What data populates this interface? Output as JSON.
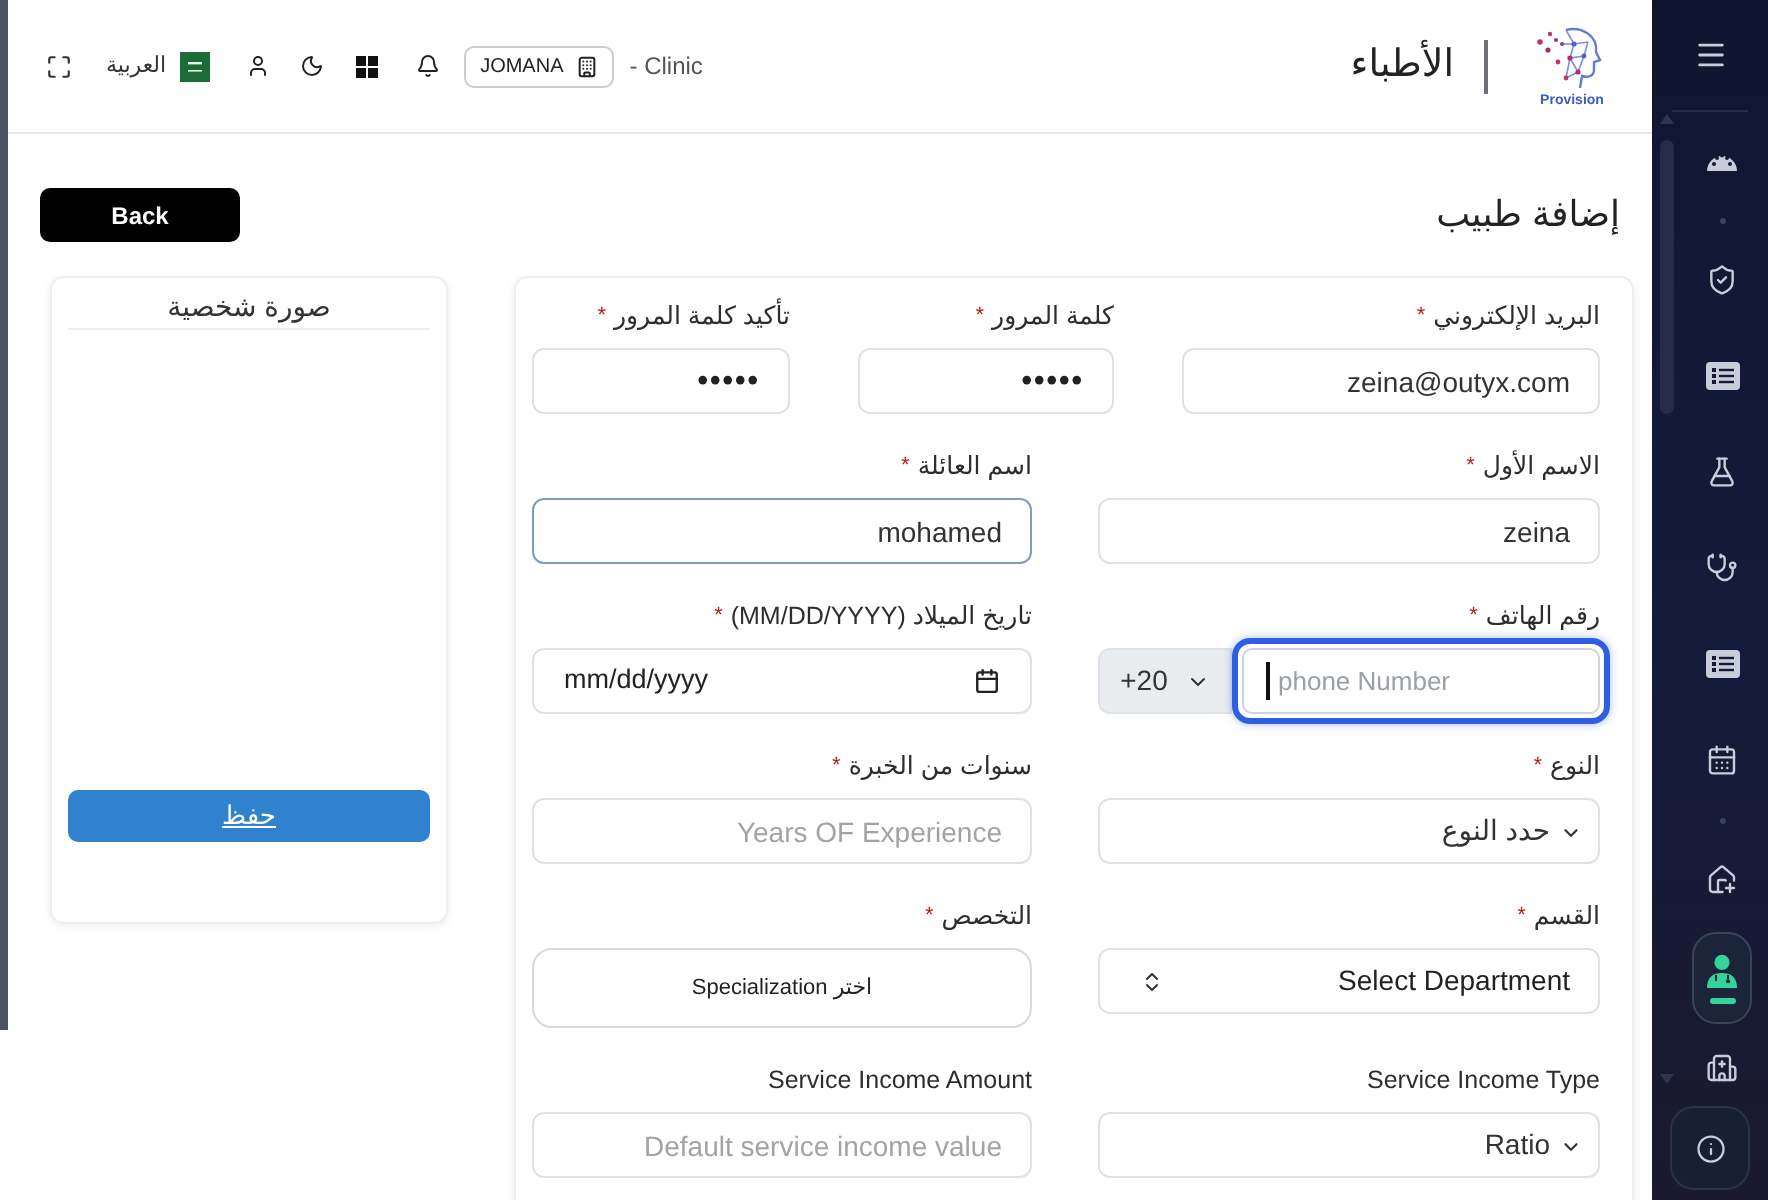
{
  "header": {
    "logo_text": "Provision",
    "title": "الأطباء",
    "language": "العربية",
    "branch": "JOMANA",
    "clinic": "- Clinic"
  },
  "page": {
    "back_button": "Back",
    "title": "إضافة طبيب"
  },
  "photo_card": {
    "title": "صورة شخصية",
    "save_button": "حفظ"
  },
  "form": {
    "rows": [
      {
        "fields": [
          {
            "kind": "text",
            "label": "البريد الإلكتروني",
            "required_mark": "*",
            "value": "zeina@outyx.com",
            "focused": false,
            "highlighted": false
          },
          {
            "kind": "password",
            "label": "كلمة المرور",
            "required_mark": "*",
            "value": "•••••",
            "focused": false,
            "highlighted": false
          },
          {
            "kind": "password",
            "label": "تأكيد كلمة المرور",
            "required_mark": "*",
            "value": "•••••",
            "focused": false,
            "highlighted": false
          }
        ]
      },
      {
        "fields": [
          {
            "kind": "text",
            "label": "الاسم الأول",
            "required_mark": "*",
            "value": "zeina",
            "focused": false,
            "highlighted": false
          },
          {
            "kind": "text",
            "label": "اسم العائلة",
            "required_mark": "*",
            "value": "mohamed",
            "focused": false,
            "highlighted": true
          }
        ]
      },
      {
        "fields": [
          {
            "kind": "phone",
            "label": "رقم الهاتف",
            "required_mark": "*",
            "country_code": "+20",
            "placeholder": "phone Number",
            "focused": true,
            "highlighted": false
          },
          {
            "kind": "date",
            "label": "تاريخ الميلاد (MM/DD/YYYY)",
            "required_mark": "*",
            "placeholder": "mm/dd/yyyy",
            "focused": false,
            "highlighted": false
          }
        ]
      },
      {
        "fields": [
          {
            "kind": "select",
            "label": "النوع",
            "required_mark": "*",
            "value": "حدد النوع",
            "focused": false,
            "highlighted": false
          },
          {
            "kind": "text",
            "label": "سنوات من الخبرة",
            "required_mark": "*",
            "placeholder": "Years OF Experience",
            "focused": false,
            "highlighted": false
          }
        ]
      },
      {
        "fields": [
          {
            "kind": "updown_select",
            "label": "القسم",
            "required_mark": "*",
            "value": "Select Department",
            "focused": false,
            "highlighted": false
          },
          {
            "kind": "search_select",
            "label": "التخصص",
            "required_mark": "*",
            "value": "اختر Specialization",
            "focused": false,
            "highlighted": false
          }
        ]
      },
      {
        "fields": [
          {
            "kind": "select",
            "label": "Service Income Type",
            "value": "Ratio",
            "focused": false,
            "highlighted": false
          },
          {
            "kind": "text",
            "label": "Service Income Amount",
            "placeholder": "Default service income value",
            "focused": false,
            "highlighted": false
          }
        ]
      }
    ]
  },
  "sidebar": {
    "items": [
      {
        "selected": false
      },
      {
        "selected": false
      },
      {
        "selected": false
      },
      {
        "selected": false
      },
      {
        "selected": false
      },
      {
        "selected": false
      },
      {
        "selected": false
      },
      {
        "selected": false
      },
      {
        "selected": true
      },
      {
        "selected": false
      }
    ]
  }
}
